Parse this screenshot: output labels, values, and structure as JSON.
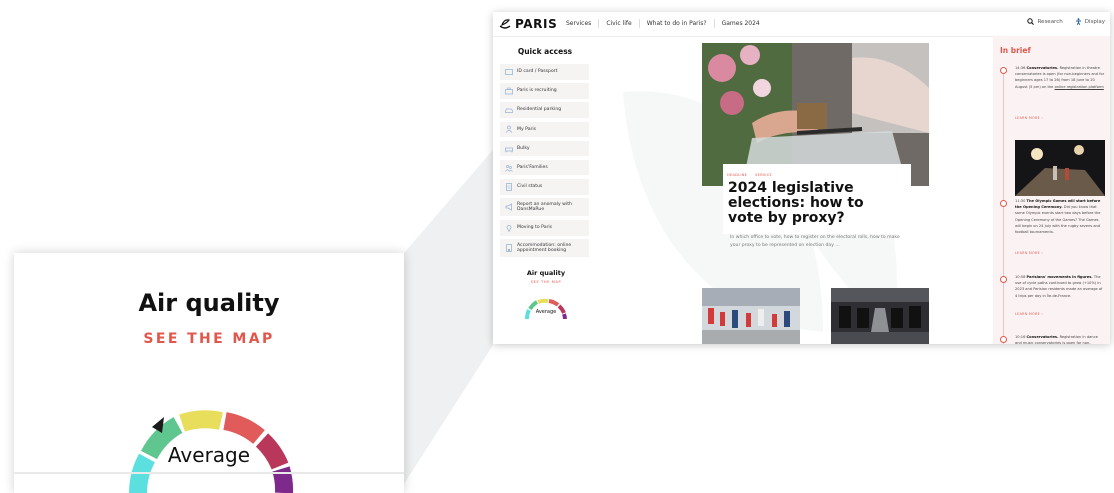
{
  "zoom": {
    "title": "Air quality",
    "link": "SEE THE MAP",
    "level": "Average"
  },
  "header": {
    "logo": "PARIS",
    "nav": [
      "Services",
      "Civic life",
      "What to do in Paris?",
      "Games 2024"
    ],
    "search": "Research",
    "display": "Display"
  },
  "sidebar": {
    "title": "Quick access",
    "items": [
      {
        "label": "ID card / Passport",
        "icon": "id-card-icon"
      },
      {
        "label": "Paris is recruiting",
        "icon": "briefcase-icon"
      },
      {
        "label": "Residential parking",
        "icon": "car-icon"
      },
      {
        "label": "My Paris",
        "icon": "person-icon"
      },
      {
        "label": "Bulky",
        "icon": "furniture-icon"
      },
      {
        "label": "Paris'Families",
        "icon": "family-icon"
      },
      {
        "label": "Civil status",
        "icon": "document-icon"
      },
      {
        "label": "Report an anomaly with DansMaRue",
        "icon": "megaphone-icon"
      },
      {
        "label": "Moving to Paris",
        "icon": "pin-icon"
      },
      {
        "label": "Accommodation: online appointment booking",
        "icon": "building-icon"
      }
    ],
    "air_title": "Air quality",
    "air_link": "SEE THE MAP",
    "air_level": "Average"
  },
  "main": {
    "tags": [
      "HEADLINE",
      "SERVICE"
    ],
    "title": "2024 legislative elections: how to vote by proxy?",
    "description": "In which office to vote, how to register on the electoral rolls, how to make your proxy to be represented on election day ..."
  },
  "in_brief": {
    "title": "In brief",
    "more": "LEARN MORE ›",
    "items": [
      {
        "time": "14:36",
        "headline": "Conservatories.",
        "text": "Registration in theatre conservatories is open (for non-beginners and for beginners ages 17 to 26) from 18 June to 20 August (5 pm) on the",
        "link": "online registration platform"
      },
      {
        "time": "11:30",
        "headline": "The Olympic Games will start before the Opening Ceremony.",
        "text": "Did you know that some Olympic events start two days before the Opening Ceremony of the Games? The Games will begin on 24 July with the rugby sevens and football tournaments."
      },
      {
        "time": "10:58",
        "headline": "Parisians' movements in figures.",
        "text": "The use of cycle paths continued to grow (+10%) in 2023 and Parisian residents made an average of 4 trips per day in Île-de-France."
      },
      {
        "time": "10:16",
        "headline": "Conservatories.",
        "text": "Registration in dance and music conservatories is open for non-beginners from June 18 to"
      }
    ]
  },
  "colors": {
    "accent": "#e2574c",
    "gauge": [
      "#5ce0df",
      "#5fc68f",
      "#e9de5b",
      "#e25b5b",
      "#b9375a",
      "#7d2a8c"
    ]
  }
}
